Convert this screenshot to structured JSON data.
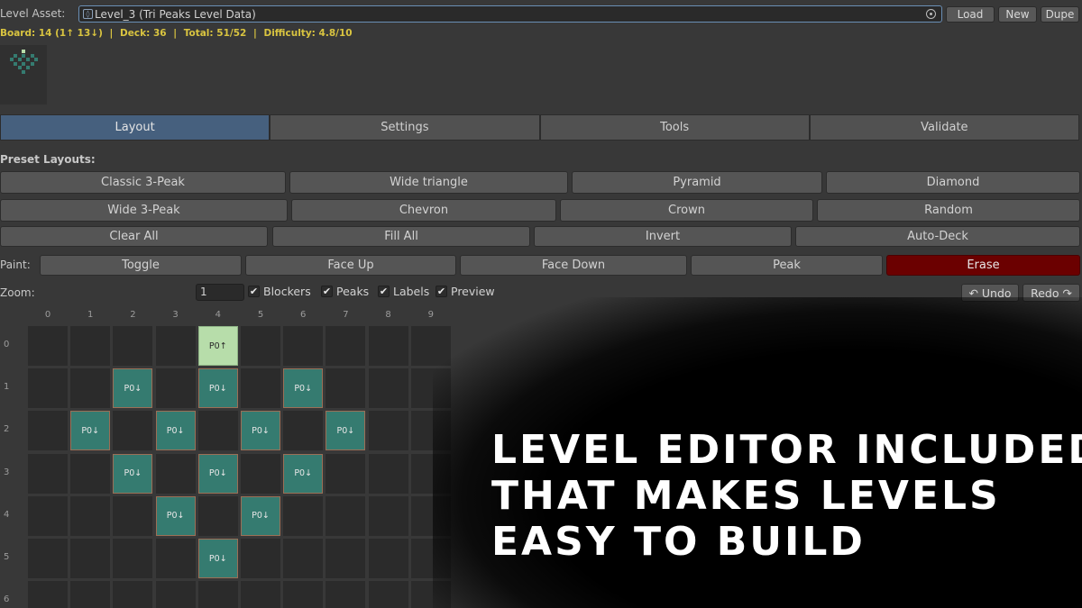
{
  "asset": {
    "label": "Level Asset:",
    "value": "Level_3 (Tri Peaks Level Data)",
    "asset_icon": "scriptable-object-icon",
    "picker_icon": "object-picker-icon",
    "load_label": "Load",
    "new_label": "New",
    "dupe_label": "Dupe"
  },
  "stats": {
    "board": "Board: 14 (1↑ 13↓)",
    "deck": "Deck: 36",
    "total": "Total: 51/52",
    "difficulty": "Difficulty: 4.8/10",
    "separator": "|",
    "color": "#d9c440"
  },
  "tabs": [
    {
      "label": "Layout",
      "active": true
    },
    {
      "label": "Settings",
      "active": false
    },
    {
      "label": "Tools",
      "active": false
    },
    {
      "label": "Validate",
      "active": false
    }
  ],
  "presets": {
    "label": "Preset Layouts:",
    "row1": [
      "Classic 3-Peak",
      "Wide triangle",
      "Pyramid",
      "Diamond"
    ],
    "row2": [
      "Wide 3-Peak",
      "Chevron",
      "Crown",
      "Random"
    ],
    "row3": [
      "Clear All",
      "Fill All",
      "Invert",
      "Auto-Deck"
    ]
  },
  "paint": {
    "label": "Paint:",
    "modes": [
      "Toggle",
      "Face Up",
      "Face Down",
      "Peak",
      "Erase"
    ],
    "selected": "Erase",
    "erase_color": "#6b0000"
  },
  "zoom": {
    "label": "Zoom:",
    "value": "1",
    "toggles": [
      {
        "label": "Blockers",
        "checked": true
      },
      {
        "label": "Peaks",
        "checked": true
      },
      {
        "label": "Labels",
        "checked": true
      },
      {
        "label": "Preview",
        "checked": true
      }
    ],
    "check_glyph": "✔",
    "undo_label": "↶ Undo",
    "redo_label": "Redo ↷"
  },
  "grid": {
    "columns": [
      "0",
      "1",
      "2",
      "3",
      "4",
      "5",
      "6",
      "7",
      "8",
      "9"
    ],
    "rows": [
      "0",
      "1",
      "2",
      "3",
      "4",
      "5",
      "6"
    ],
    "tiles": [
      {
        "row": 0,
        "col": 4,
        "label": "P0↑",
        "face_up": true
      },
      {
        "row": 1,
        "col": 2,
        "label": "P0↓",
        "face_up": false
      },
      {
        "row": 1,
        "col": 4,
        "label": "P0↓",
        "face_up": false
      },
      {
        "row": 1,
        "col": 6,
        "label": "P0↓",
        "face_up": false
      },
      {
        "row": 2,
        "col": 1,
        "label": "P0↓",
        "face_up": false
      },
      {
        "row": 2,
        "col": 3,
        "label": "P0↓",
        "face_up": false
      },
      {
        "row": 2,
        "col": 5,
        "label": "P0↓",
        "face_up": false
      },
      {
        "row": 2,
        "col": 7,
        "label": "P0↓",
        "face_up": false
      },
      {
        "row": 3,
        "col": 2,
        "label": "P0↓",
        "face_up": false
      },
      {
        "row": 3,
        "col": 4,
        "label": "P0↓",
        "face_up": false
      },
      {
        "row": 3,
        "col": 6,
        "label": "P0↓",
        "face_up": false
      },
      {
        "row": 4,
        "col": 3,
        "label": "P0↓",
        "face_up": false
      },
      {
        "row": 4,
        "col": 5,
        "label": "P0↓",
        "face_up": false
      },
      {
        "row": 5,
        "col": 4,
        "label": "P0↓",
        "face_up": false
      }
    ],
    "face_down_color": "#357b70",
    "face_up_color": "#b7ddaa"
  },
  "promo": {
    "lines": [
      "LEVEL EDITOR INCLUDED",
      "THAT MAKES LEVELS",
      "EASY TO  BUILD"
    ]
  }
}
